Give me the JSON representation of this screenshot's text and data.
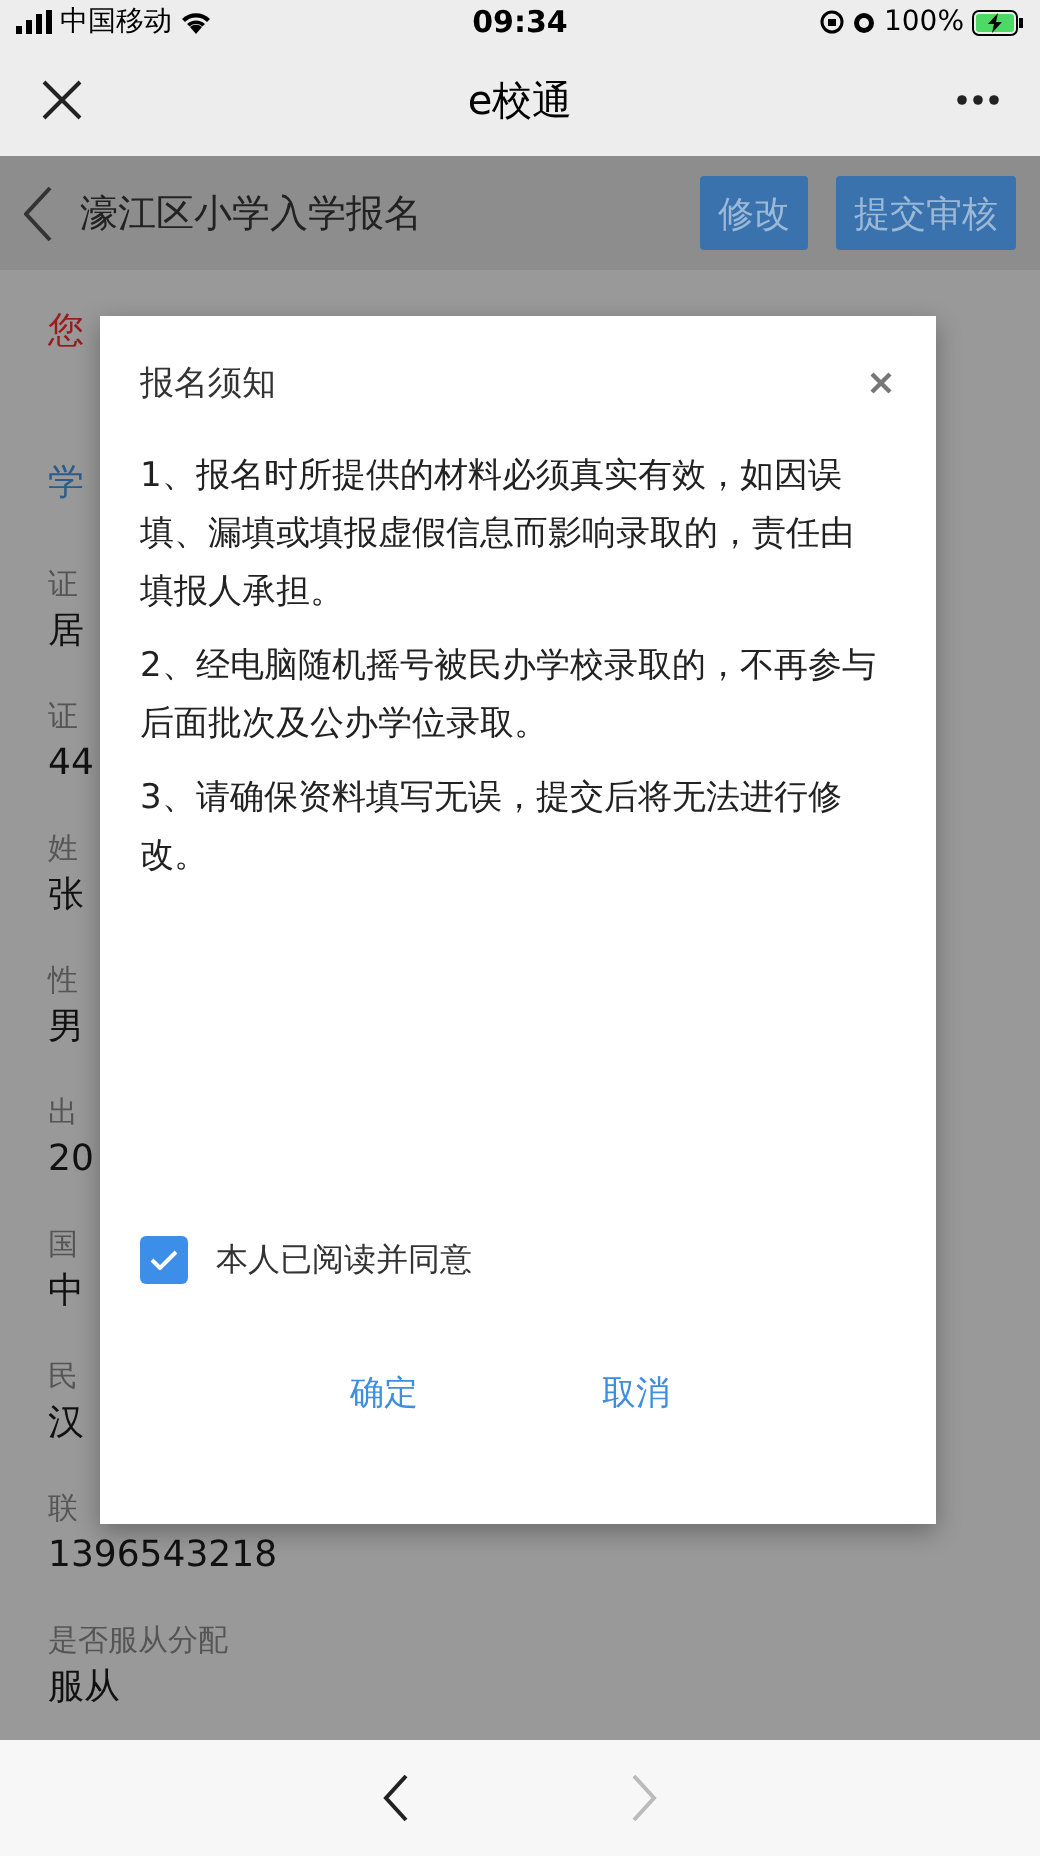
{
  "status_bar": {
    "carrier": "中国移动",
    "time": "09:34",
    "battery": "100%"
  },
  "nav": {
    "title": "e校通"
  },
  "header": {
    "title": "濠江区小学入学报名",
    "buttons": [
      {
        "label": "修改"
      },
      {
        "label": "提交审核"
      }
    ]
  },
  "notice": "您",
  "page": {
    "section": "学",
    "fields": [
      {
        "label": "证",
        "value": "居"
      },
      {
        "label": "证",
        "value": "44"
      },
      {
        "label": "姓",
        "value": "张"
      },
      {
        "label": "性",
        "value": "男"
      },
      {
        "label": "出",
        "value": "20"
      },
      {
        "label": "国",
        "value": "中"
      },
      {
        "label": "民",
        "value": "汉"
      },
      {
        "label": "联",
        "value": "1396543218"
      },
      {
        "label": "是否服从分配",
        "value": "服从"
      }
    ]
  },
  "dialog": {
    "title": "报名须知",
    "items": [
      "1、报名时所提供的材料必须真实有效，如因误填、漏填或填报虚假信息而影响录取的，责任由填报人承担。",
      "2、经电脑随机摇号被民办学校录取的，不再参与后面批次及公办学位录取。",
      "3、请确保资料填写无误，提交后将无法进行修改。"
    ],
    "agree": {
      "label": "本人已阅读并同意",
      "checked": true
    },
    "buttons": [
      {
        "label": "确定"
      },
      {
        "label": "取消"
      }
    ]
  },
  "browser_bar": {
    "back": {
      "disabled": false
    },
    "forward": {
      "disabled": true
    }
  }
}
